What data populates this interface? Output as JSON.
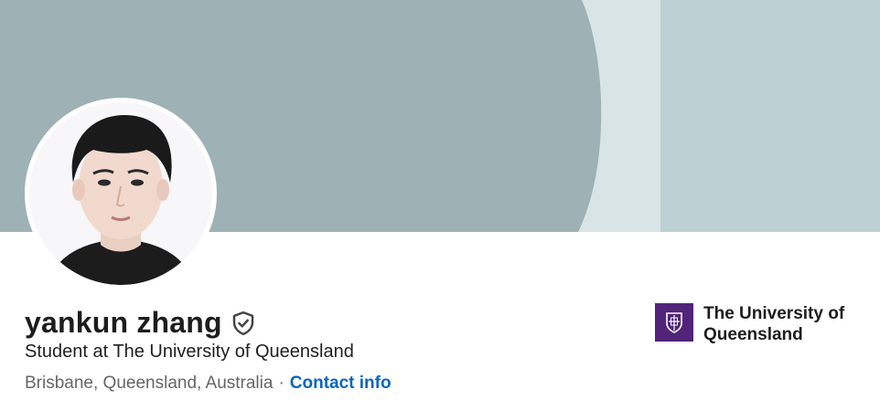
{
  "profile": {
    "name": "yankun zhang",
    "headline": "Student at The University of Queensland",
    "location": "Brisbane, Queensland, Australia",
    "separator": "·",
    "contact_label": "Contact info"
  },
  "organization": {
    "name": "The University of Queensland",
    "logo_color": "#51247a"
  },
  "icons": {
    "verified": "verified-shield-icon",
    "org_logo": "university-crest-icon",
    "avatar": "profile-photo"
  },
  "colors": {
    "banner_dark": "#9eb1b5",
    "banner_light": "#bdd0d4",
    "banner_stripe": "#d9e4e6",
    "link": "#0a66c2"
  }
}
